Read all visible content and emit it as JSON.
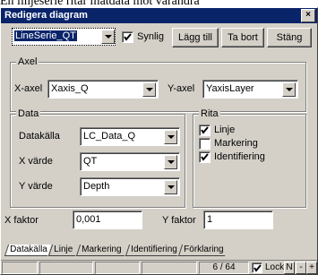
{
  "background_text": "En linjeserie ritar mätdata mot varandra",
  "window": {
    "title": "Redigera diagram",
    "close_glyph": "×"
  },
  "toolbar": {
    "series_select": "LineSerie_QT",
    "visible_label": "Synlig",
    "visible_checked": true,
    "add_label": "Lägg till",
    "remove_label": "Ta bort",
    "close_label": "Stäng"
  },
  "axel": {
    "title": "Axel",
    "x_label": "X-axel",
    "x_value": "Xaxis_Q",
    "y_label": "Y-axel",
    "y_value": "YaxisLayer"
  },
  "data": {
    "title": "Data",
    "source_label": "Datakälla",
    "source_value": "LC_Data_Q",
    "x_label": "X värde",
    "x_value": "QT",
    "y_label": "Y värde",
    "y_value": "Depth"
  },
  "rita": {
    "title": "Rita",
    "items": [
      {
        "label": "Linje",
        "checked": true
      },
      {
        "label": "Markering",
        "checked": false
      },
      {
        "label": "Identifiering",
        "checked": true
      }
    ]
  },
  "factors": {
    "x_label": "X faktor",
    "x_value": "0,001",
    "y_label": "Y faktor",
    "y_value": "1"
  },
  "tabs": [
    {
      "label": "Datakälla",
      "active": true
    },
    {
      "label": "Linje",
      "active": false
    },
    {
      "label": "Markering",
      "active": false
    },
    {
      "label": "Identifiering",
      "active": false
    },
    {
      "label": "Förklaring",
      "active": false
    }
  ],
  "status": {
    "page": "6 / 64",
    "lock_label": "Lock",
    "lock_checked": true,
    "btn_n": "N",
    "btn_minus": "-",
    "btn_plus": "+"
  },
  "icons": {
    "close": "close-icon",
    "dropdown": "chevron-down-icon",
    "check": "checkmark-icon"
  },
  "colors": {
    "titlebar": "#0a246a",
    "face": "#d4d0c8"
  }
}
